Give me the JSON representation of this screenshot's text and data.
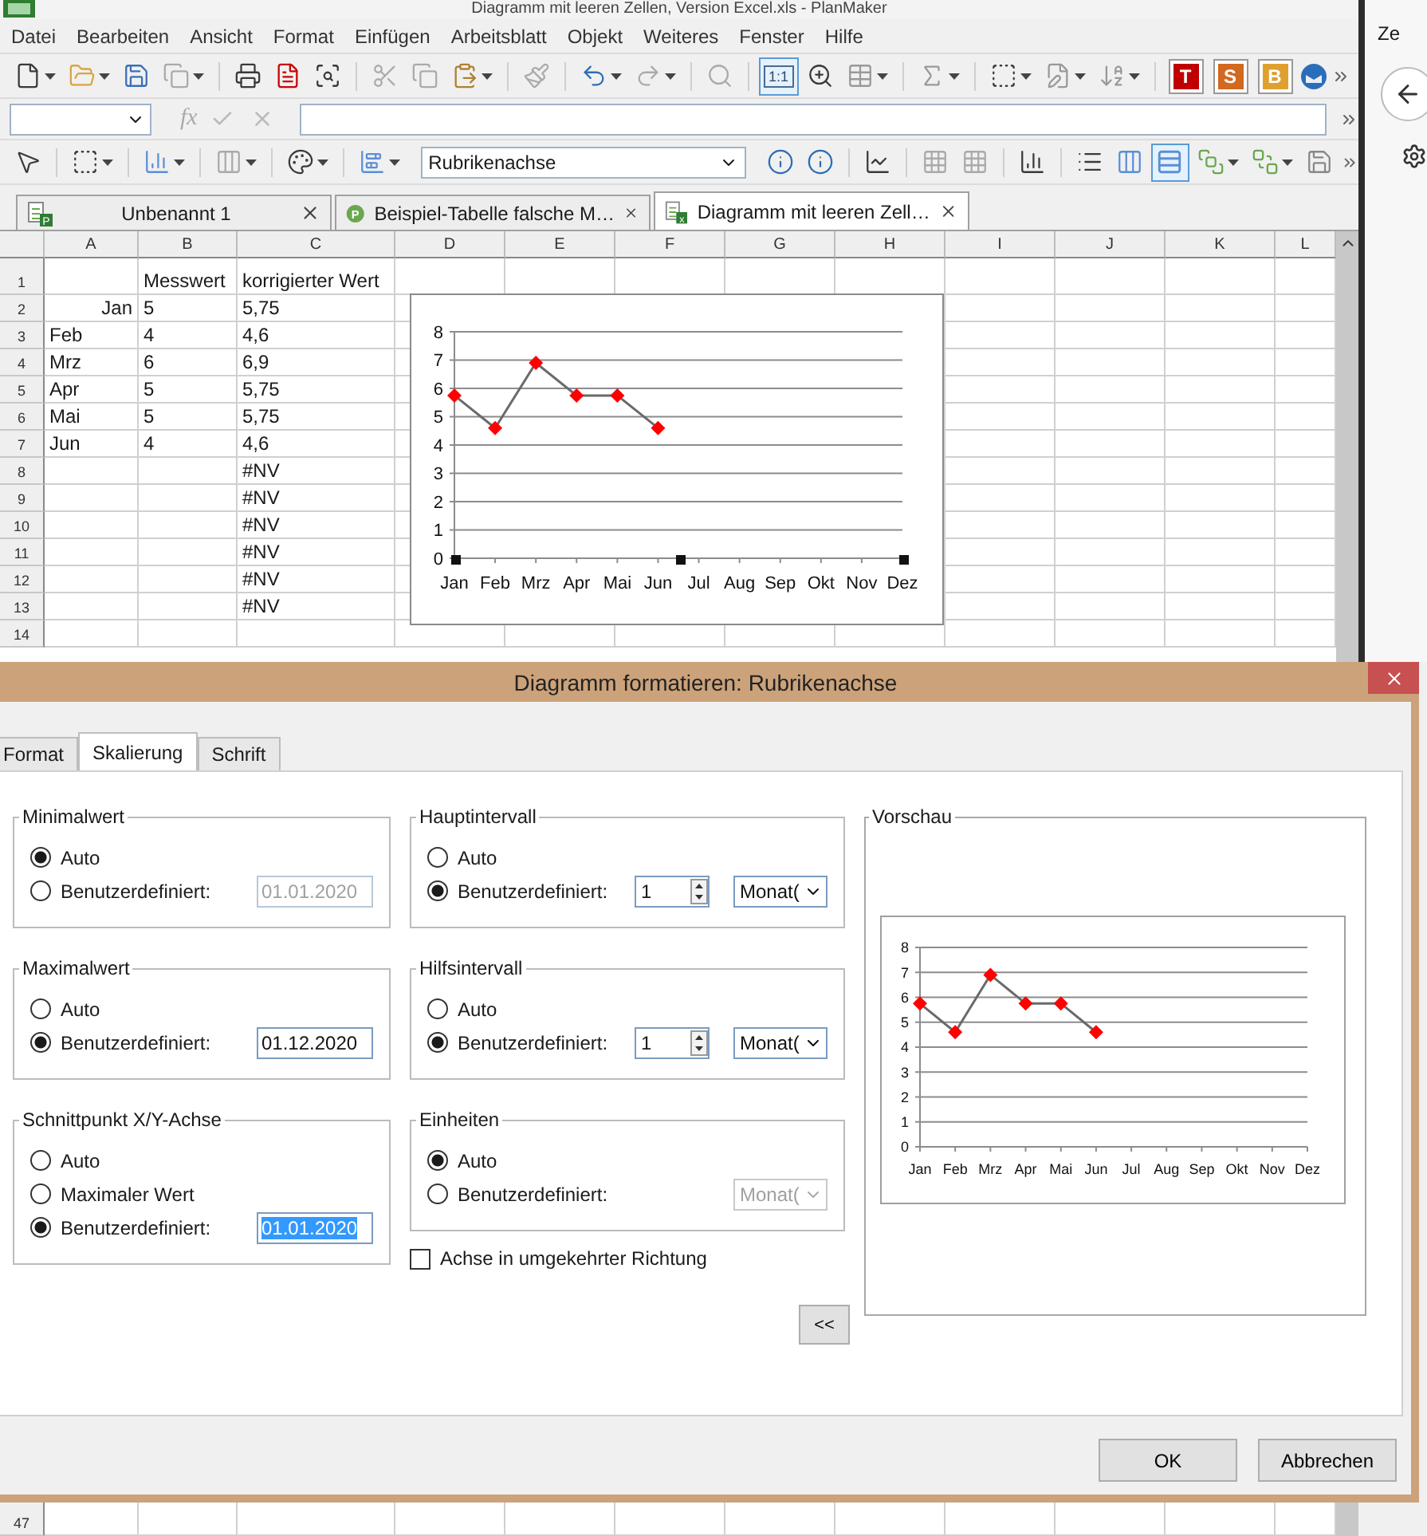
{
  "window": {
    "title": "Diagramm mit leeren Zellen, Version Excel.xls - PlanMaker"
  },
  "menu": [
    "Datei",
    "Bearbeiten",
    "Ansicht",
    "Format",
    "Einfügen",
    "Arbeitsblatt",
    "Objekt",
    "Weiteres",
    "Fenster",
    "Hilfe"
  ],
  "toolbar": {
    "zoom_button": {
      "label": "1:1",
      "active": true
    },
    "app_buttons": [
      {
        "label": "T",
        "color": "#c00000"
      },
      {
        "label": "S",
        "color": "#d2691e"
      },
      {
        "label": "B",
        "color": "#e0a030"
      }
    ]
  },
  "formula_bar": {
    "function_label": "fx"
  },
  "chart_toolbar": {
    "element": "Rubrikenachse",
    "gridlines_active": true
  },
  "doc_tabs": [
    {
      "label": "Unbenannt 1",
      "kind": "sheet",
      "icon_label": "P",
      "selected": false
    },
    {
      "label": "Beispiel-Tabelle falsche M…",
      "kind": "circle",
      "icon_label": "P",
      "selected": false
    },
    {
      "label": "Diagramm mit leeren Zell…",
      "kind": "sheet",
      "icon_label": "x",
      "selected": true
    }
  ],
  "sheet": {
    "columns": [
      "A",
      "B",
      "C",
      "D",
      "E",
      "F",
      "G",
      "H",
      "I",
      "J",
      "K",
      "L"
    ],
    "rows": [
      {
        "number": "1",
        "cells": [
          "",
          "Messwert",
          "korrigierter Wert"
        ]
      },
      {
        "number": "2",
        "cells": [
          {
            "text": "Jan",
            "right_aligned": true
          },
          "5",
          "5,75"
        ]
      },
      {
        "number": "3",
        "cells": [
          "Feb",
          "4",
          "4,6"
        ]
      },
      {
        "number": "4",
        "cells": [
          "Mrz",
          "6",
          "6,9"
        ]
      },
      {
        "number": "5",
        "cells": [
          "Apr",
          "5",
          "5,75"
        ]
      },
      {
        "number": "6",
        "cells": [
          "Mai",
          "5",
          "5,75"
        ]
      },
      {
        "number": "7",
        "cells": [
          "Jun",
          "4",
          "4,6"
        ]
      },
      {
        "number": "8",
        "cells": [
          "",
          "",
          "#NV"
        ]
      },
      {
        "number": "9",
        "cells": [
          "",
          "",
          "#NV"
        ]
      },
      {
        "number": "10",
        "cells": [
          "",
          "",
          "#NV"
        ]
      },
      {
        "number": "11",
        "cells": [
          "",
          "",
          "#NV"
        ]
      },
      {
        "number": "12",
        "cells": [
          "",
          "",
          "#NV"
        ]
      },
      {
        "number": "13",
        "cells": [
          "",
          "",
          "#NV"
        ]
      },
      {
        "number": "14",
        "cells": []
      }
    ],
    "chart": {
      "selected": true,
      "chart_data": {
        "type": "line",
        "categories": [
          "Jan",
          "Feb",
          "Mrz",
          "Apr",
          "Mai",
          "Jun",
          "Jul",
          "Aug",
          "Sep",
          "Okt",
          "Nov",
          "Dez"
        ],
        "series": [
          {
            "color": "#ff0000",
            "marker": "diamond",
            "values": [
              5.75,
              4.6,
              6.9,
              5.75,
              5.75,
              4.6,
              null,
              null,
              null,
              null,
              null,
              null
            ]
          }
        ],
        "ylim": [
          0,
          8
        ],
        "yticks": [
          0,
          1,
          2,
          3,
          4,
          5,
          6,
          7,
          8
        ],
        "grid": true
      }
    }
  },
  "dialog": {
    "title": "Diagramm formatieren: Rubrikenachse",
    "tabs": [
      {
        "label": "Format",
        "selected": false
      },
      {
        "label": "Skalierung",
        "selected": true
      },
      {
        "label": "Schrift",
        "selected": false
      }
    ],
    "left_groups": [
      {
        "title": "Minimalwert",
        "options": [
          {
            "label": "Auto",
            "selected": true
          },
          {
            "label": "Benutzerdefiniert:",
            "selected": false
          }
        ],
        "field": {
          "kind": "date",
          "value": "01.01.2020",
          "disabled": true
        }
      },
      {
        "title": "Maximalwert",
        "options": [
          {
            "label": "Auto",
            "selected": false
          },
          {
            "label": "Benutzerdefiniert:",
            "selected": true
          }
        ],
        "field": {
          "kind": "date",
          "value": "01.12.2020",
          "disabled": false
        }
      },
      {
        "title": "Schnittpunkt X/Y-Achse",
        "options": [
          {
            "label": "Auto",
            "selected": false
          },
          {
            "label": "Maximaler Wert",
            "selected": false
          },
          {
            "label": "Benutzerdefiniert:",
            "selected": true
          }
        ],
        "field": {
          "kind": "date",
          "value": "01.01.2020",
          "disabled": false,
          "text_selected": true
        }
      }
    ],
    "middle_groups": [
      {
        "title": "Hauptintervall",
        "options": [
          {
            "label": "Auto",
            "selected": false
          },
          {
            "label": "Benutzerdefiniert:",
            "selected": true
          }
        ],
        "field": {
          "kind": "spin_select",
          "value": "1",
          "unit": "Monat(",
          "disabled": false
        }
      },
      {
        "title": "Hilfsintervall",
        "options": [
          {
            "label": "Auto",
            "selected": false
          },
          {
            "label": "Benutzerdefiniert:",
            "selected": true
          }
        ],
        "field": {
          "kind": "spin_select",
          "value": "1",
          "unit": "Monat(",
          "disabled": false
        }
      },
      {
        "title": "Einheiten",
        "options": [
          {
            "label": "Auto",
            "selected": true
          },
          {
            "label": "Benutzerdefiniert:",
            "selected": false
          }
        ],
        "field": {
          "kind": "select",
          "unit": "Monat(",
          "disabled": true
        }
      }
    ],
    "reverse_axis": {
      "label": "Achse in umgekehrter Richtung",
      "checked": false
    },
    "collapse_button": "<<",
    "preview": {
      "title": "Vorschau",
      "chart_data": {
        "type": "line",
        "categories": [
          "Jan",
          "Feb",
          "Mrz",
          "Apr",
          "Mai",
          "Jun",
          "Jul",
          "Aug",
          "Sep",
          "Okt",
          "Nov",
          "Dez"
        ],
        "series": [
          {
            "color": "#ff0000",
            "marker": "diamond",
            "values": [
              5.75,
              4.6,
              6.9,
              5.75,
              5.75,
              4.6,
              null,
              null,
              null,
              null,
              null,
              null
            ]
          }
        ],
        "ylim": [
          0,
          8
        ],
        "yticks": [
          0,
          1,
          2,
          3,
          4,
          5,
          6,
          7,
          8
        ],
        "grid": true
      }
    },
    "buttons": [
      "OK",
      "Abbrechen"
    ]
  },
  "sheet_bottom": {
    "number": "47"
  },
  "side_panel": {
    "text": "Ze"
  }
}
